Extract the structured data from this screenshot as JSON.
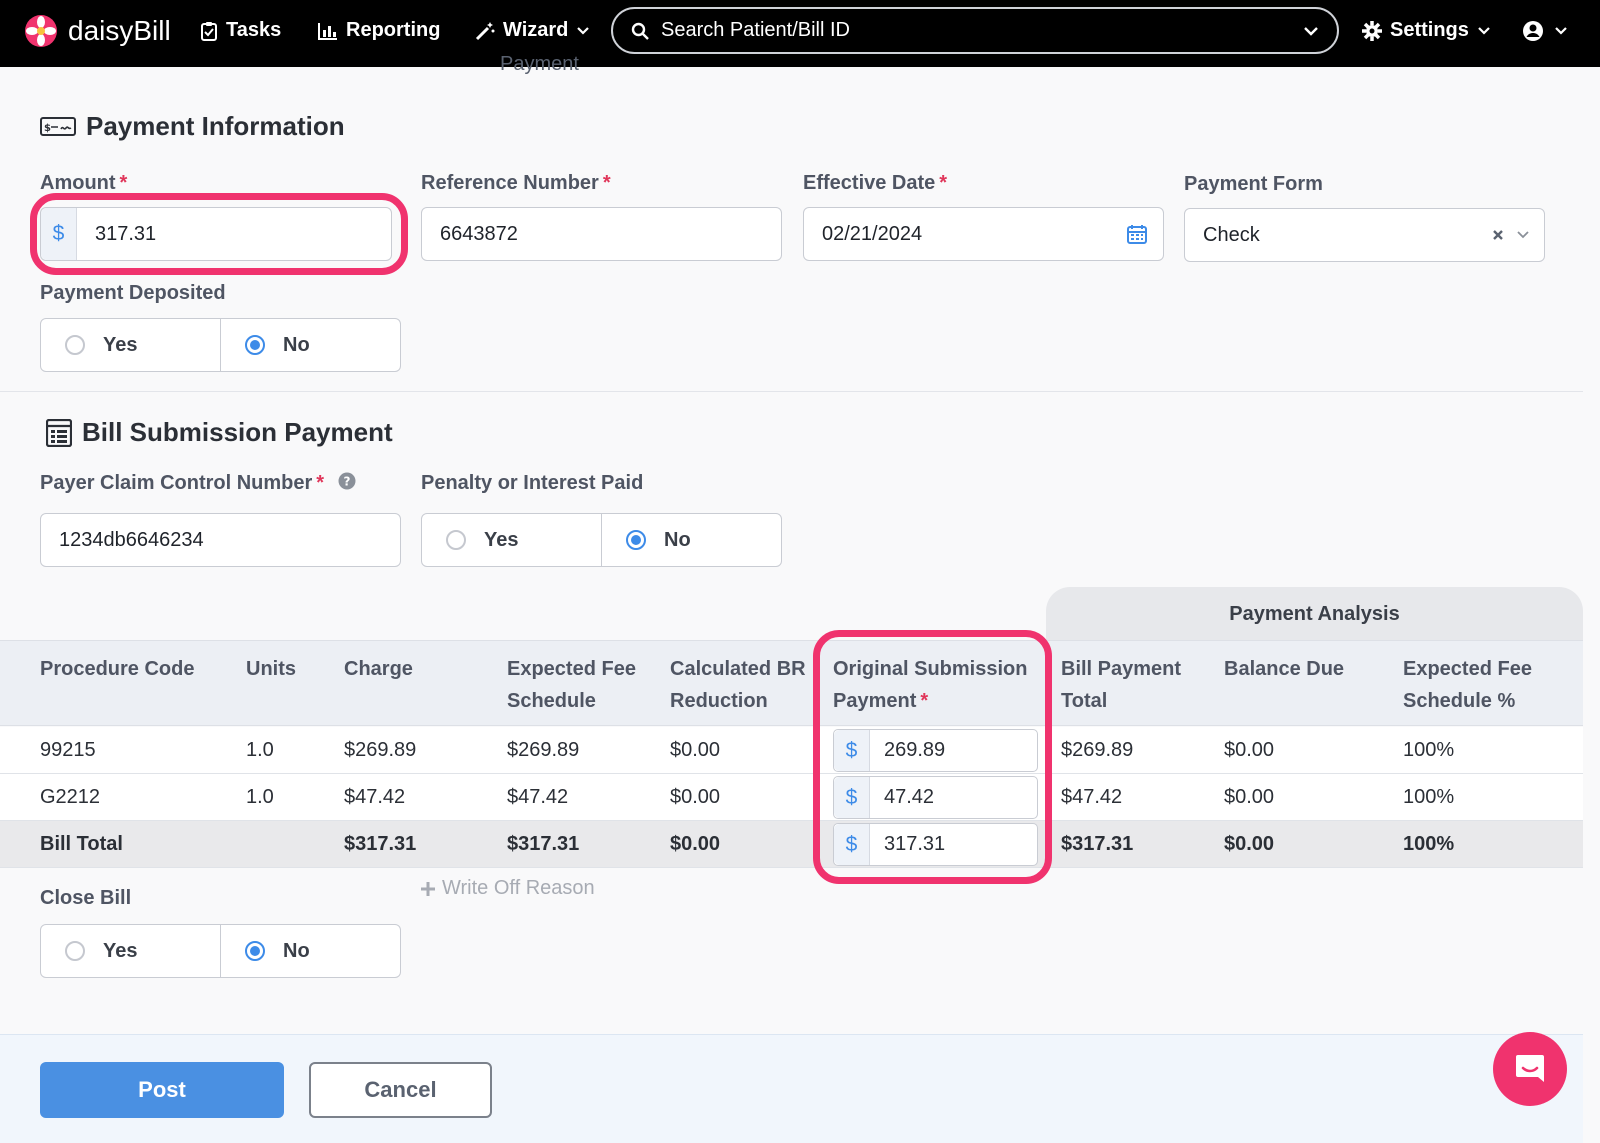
{
  "app": {
    "brand": "daisyBill"
  },
  "nav": {
    "tasks": "Tasks",
    "reporting": "Reporting",
    "wizard": "Wizard",
    "settings": "Settings"
  },
  "search": {
    "placeholder": "Search Patient/Bill ID"
  },
  "peek_text": "Payment",
  "payment_info": {
    "title": "Payment Information",
    "amount_label": "Amount",
    "amount_value": "317.31",
    "reference_label": "Reference Number",
    "reference_value": "6643872",
    "effective_date_label": "Effective Date",
    "effective_date_value": "02/21/2024",
    "payment_form_label": "Payment Form",
    "payment_form_value": "Check",
    "deposited_label": "Payment Deposited",
    "deposited_options": [
      "Yes",
      "No"
    ],
    "deposited_selected": "No"
  },
  "bill_submission": {
    "title": "Bill Submission Payment",
    "claim_label": "Payer Claim Control Number",
    "claim_value": "1234db6646234",
    "penalty_label": "Penalty or Interest Paid",
    "penalty_options": [
      "Yes",
      "No"
    ],
    "penalty_selected": "No"
  },
  "table": {
    "analysis_header": "Payment Analysis",
    "columns": {
      "procedure": "Procedure Code",
      "units": "Units",
      "charge": "Charge",
      "expected1": "Expected Fee",
      "expected2": "Schedule",
      "calc1": "Calculated BR",
      "calc2": "Reduction",
      "orig1": "Original Submission",
      "orig2": "Payment",
      "billpay1": "Bill Payment",
      "billpay2": "Total",
      "balance": "Balance Due",
      "pct1": "Expected Fee",
      "pct2": "Schedule %"
    },
    "rows": [
      {
        "procedure": "99215",
        "units": "1.0",
        "charge": "$269.89",
        "expected": "$269.89",
        "calc": "$0.00",
        "orig": "269.89",
        "billpay": "$269.89",
        "balance": "$0.00",
        "pct": "100%"
      },
      {
        "procedure": "G2212",
        "units": "1.0",
        "charge": "$47.42",
        "expected": "$47.42",
        "calc": "$0.00",
        "orig": "47.42",
        "billpay": "$47.42",
        "balance": "$0.00",
        "pct": "100%"
      }
    ],
    "total": {
      "label": "Bill Total",
      "charge": "$317.31",
      "expected": "$317.31",
      "calc": "$0.00",
      "orig": "317.31",
      "billpay": "$317.31",
      "balance": "$0.00",
      "pct": "100%"
    }
  },
  "close_bill": {
    "label": "Close Bill",
    "options": [
      "Yes",
      "No"
    ],
    "selected": "No",
    "write_off": "Write Off Reason"
  },
  "footer": {
    "post": "Post",
    "cancel": "Cancel"
  },
  "currency_symbol": "$",
  "required_mark": "*",
  "colors": {
    "accent": "#4a90e2",
    "highlight": "#f0336e",
    "topbar": "#000000"
  }
}
